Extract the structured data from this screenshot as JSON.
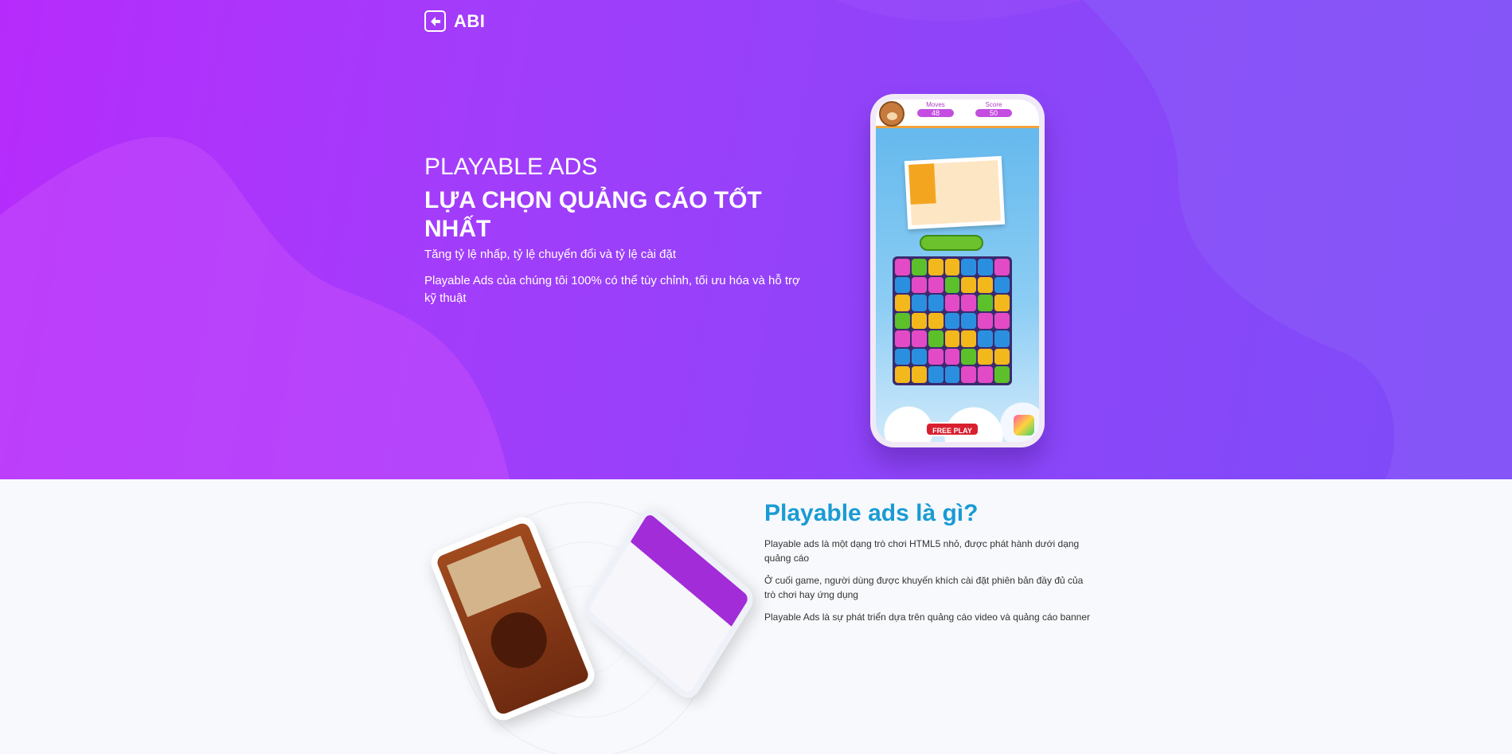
{
  "brand": {
    "name": "ABI",
    "logo_icon": "abi-logo-icon"
  },
  "hero": {
    "title": "PLAYABLE ADS",
    "subtitle": "LỰA CHỌN QUẢNG CÁO TỐT NHẤT",
    "tagline": "Tăng tỷ lệ nhấp, tỷ lệ chuyển đổi và tỷ lệ cài đặt",
    "description": "Playable Ads của chúng tôi 100% có thể tùy chỉnh, tối ưu hóa và hỗ trợ kỹ thuật"
  },
  "game_preview": {
    "moves_label": "Moves",
    "moves_value": "48",
    "score_label": "Score",
    "score_value": "50",
    "cta_label": "FREE PLAY"
  },
  "about": {
    "title": "Playable ads là gì?",
    "paragraphs": [
      "Playable ads là một dạng trò chơi HTML5 nhỏ, được phát hành dưới dạng quảng cáo",
      "Ở cuối game, người dùng được khuyến khích cài đặt phiên bản đầy đủ của trò chơi hay ứng dụng",
      "Playable Ads là sự phát triển dựa trên quảng cáo video và quảng cáo banner"
    ]
  },
  "colors": {
    "hero_start": "#b62bfb",
    "hero_end": "#7d4cf8",
    "about_title": "#1a9bd4",
    "cta_red": "#d8202f"
  }
}
